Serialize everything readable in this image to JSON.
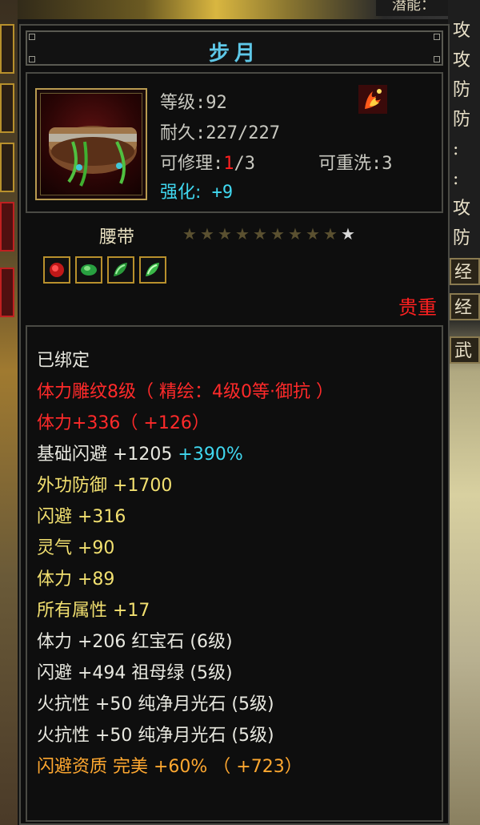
{
  "top_right_label": "潜能：",
  "side_labels": [
    "攻",
    "攻",
    "防",
    "防",
    ":",
    ":",
    "攻",
    "防"
  ],
  "side_buttons": [
    "经",
    "经",
    "武"
  ],
  "title": "步月",
  "stats": {
    "level_label": "等级",
    "level_value": ":92",
    "durability_label": "耐久",
    "durability_value": ":227/227",
    "repair_label": "可修理",
    "repair_colon": ":",
    "repair_current": "1",
    "repair_max": "/3",
    "rewash_label": "可重洗",
    "rewash_value": ":3",
    "enhance_label": "强化:",
    "enhance_value": "+9"
  },
  "item_type": "腰带",
  "stars": {
    "filled": 9,
    "total": 10
  },
  "gems": [
    "ruby-gem-icon",
    "emerald-gem-icon",
    "emerald-gem-icon",
    "emerald-gem-icon"
  ],
  "rarity": "贵重",
  "attributes": [
    {
      "text": "已绑定",
      "color": "white"
    },
    {
      "text": "体力雕纹8级（ 精绘：4级0等·御抗 ）",
      "color": "red"
    },
    {
      "text": "体力+336（ +126）",
      "color": "red"
    },
    {
      "text": "基础闪避  +1205",
      "color": "white",
      "extra": "+390%"
    },
    {
      "text": "外功防御  +1700",
      "color": "yellow"
    },
    {
      "text": "闪避  +316",
      "color": "yellow"
    },
    {
      "text": "灵气  +90",
      "color": "yellow"
    },
    {
      "text": "体力  +89",
      "color": "yellow"
    },
    {
      "text": "所有属性  +17",
      "color": "yellow"
    },
    {
      "text": "体力  +206  红宝石 (6级)",
      "color": "white"
    },
    {
      "text": "闪避  +494  祖母绿 (5级)",
      "color": "white"
    },
    {
      "text": "火抗性  +50  纯净月光石 (5级)",
      "color": "white"
    },
    {
      "text": "火抗性  +50  纯净月光石 (5级)",
      "color": "white"
    },
    {
      "text": "闪避资质   完美  +60% （ +723）",
      "color": "orange"
    }
  ],
  "colors": {
    "title": "#5ec8e8",
    "red": "#ff2020",
    "cyan": "#40d8f0",
    "yellow": "#f2e070",
    "orange": "#ffa830"
  }
}
